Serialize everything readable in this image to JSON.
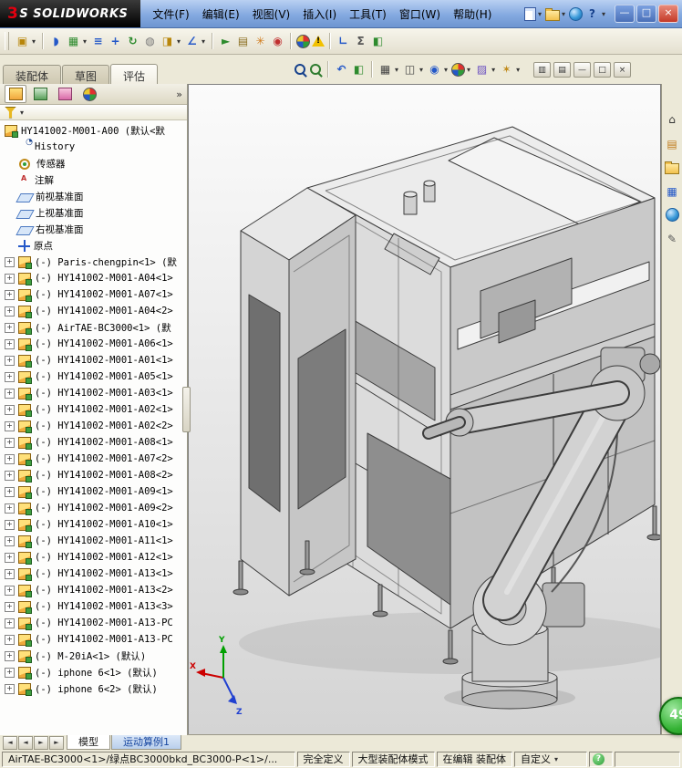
{
  "window": {
    "logo_accent": "3",
    "logo_rest": "S",
    "logo_name": "SOLIDWORKS",
    "buttons": {
      "minimize": "—",
      "maximize": "□",
      "close": "×"
    }
  },
  "menus": [
    {
      "id": "file",
      "label": "文件(F)"
    },
    {
      "id": "edit",
      "label": "编辑(E)"
    },
    {
      "id": "view",
      "label": "视图(V)"
    },
    {
      "id": "insert",
      "label": "插入(I)"
    },
    {
      "id": "tools",
      "label": "工具(T)"
    },
    {
      "id": "window",
      "label": "窗口(W)"
    },
    {
      "id": "help",
      "label": "帮助(H)"
    }
  ],
  "quick_icons": [
    {
      "id": "new-document",
      "kind": "page",
      "caret": true
    },
    {
      "id": "open",
      "kind": "folder",
      "caret": true
    },
    {
      "id": "solidworks-resources",
      "kind": "ball"
    },
    {
      "id": "help",
      "glyph": "?",
      "fg": "#16418c",
      "caret": true
    }
  ],
  "toolbar": {
    "icons": [
      {
        "id": "insert-components",
        "glyph": "▣",
        "fg": "#b8860b",
        "caret": true
      },
      {
        "sep": true
      },
      {
        "id": "mate",
        "glyph": "◗",
        "fg": "#2458c8"
      },
      {
        "id": "linear-component-pattern",
        "glyph": "▦",
        "fg": "#2e8b2e",
        "caret": true
      },
      {
        "id": "smart-fasteners",
        "glyph": "≡",
        "fg": "#2458c8"
      },
      {
        "id": "move-component",
        "glyph": "+",
        "fg": "#2458c8"
      },
      {
        "id": "rotate-component",
        "glyph": "↻",
        "fg": "#2e8b2e"
      },
      {
        "id": "show-hidden-components",
        "glyph": "◍",
        "fg": "#777777"
      },
      {
        "id": "assembly-features",
        "glyph": "◨",
        "fg": "#b8860b",
        "caret": true
      },
      {
        "id": "reference-geometry",
        "glyph": "∠",
        "fg": "#2458c8",
        "caret": true
      },
      {
        "sep": true
      },
      {
        "id": "new-motion-study",
        "glyph": "►",
        "fg": "#2e8b2e"
      },
      {
        "id": "bill-of-materials",
        "glyph": "▤",
        "fg": "#8a6d1f"
      },
      {
        "id": "exploded-view",
        "glyph": "✳",
        "fg": "#d07a1a"
      },
      {
        "id": "interference-detection",
        "glyph": "◉",
        "fg": "#c03030"
      },
      {
        "sep": true
      },
      {
        "id": "edit-appearance",
        "kind": "wheel"
      },
      {
        "id": "rebuild-warning",
        "kind": "tri",
        "glyph": "!"
      },
      {
        "sep": true
      },
      {
        "id": "measure",
        "glyph": "∟",
        "fg": "#2458c8"
      },
      {
        "id": "mass-properties",
        "glyph": "Σ",
        "fg": "#555555"
      },
      {
        "id": "section-properties",
        "glyph": "◧",
        "fg": "#2e8b2e"
      }
    ]
  },
  "command_tabs": [
    {
      "id": "assembly",
      "label": "装配体",
      "active": false
    },
    {
      "id": "sketch",
      "label": "草图",
      "active": false
    },
    {
      "id": "evaluate",
      "label": "评估",
      "active": true
    }
  ],
  "headsup": [
    {
      "id": "zoom-to-fit",
      "kind": "mag"
    },
    {
      "id": "zoom-to-area",
      "kind": "mag2"
    },
    {
      "sep": true
    },
    {
      "id": "previous-view",
      "glyph": "↶",
      "fg": "#2458c8"
    },
    {
      "id": "section-view",
      "glyph": "◧",
      "fg": "#2e8b2e"
    },
    {
      "sep": true
    },
    {
      "id": "view-orientation",
      "glyph": "▦",
      "fg": "#444444",
      "caret": true
    },
    {
      "id": "display-style",
      "glyph": "◫",
      "fg": "#444444",
      "caret": true
    },
    {
      "id": "hide-show-items",
      "glyph": "◉",
      "fg": "#2458c8",
      "caret": true
    },
    {
      "id": "edit-appearance-hud",
      "kind": "wheel",
      "caret": true
    },
    {
      "id": "apply-scene",
      "glyph": "▨",
      "fg": "#6a4fc0",
      "caret": true
    },
    {
      "id": "view-settings",
      "glyph": "✶",
      "fg": "#c08a1a",
      "caret": true
    }
  ],
  "doc_buttons": [
    {
      "id": "viewport-layout",
      "glyph": "▥"
    },
    {
      "id": "viewport-layout-2",
      "glyph": "▤"
    },
    {
      "id": "minimize-document",
      "glyph": "—"
    },
    {
      "id": "restore-document",
      "glyph": "□"
    },
    {
      "id": "close-document",
      "glyph": "×"
    }
  ],
  "panel": {
    "tabs": [
      {
        "id": "featuremanager",
        "kind": "asmtab"
      },
      {
        "id": "propertymanager",
        "kind": "proptab"
      },
      {
        "id": "configurationmanager",
        "kind": "cfgtab"
      },
      {
        "id": "displaymanager",
        "kind": "wheel"
      }
    ],
    "overflow": "»"
  },
  "tree": {
    "root": "HY141002-M001-A00 (默认<默",
    "items": [
      {
        "kind": "history",
        "label": "History"
      },
      {
        "kind": "sensor",
        "label": "传感器"
      },
      {
        "kind": "annotations",
        "label": "注解"
      },
      {
        "kind": "plane",
        "label": "前视基准面"
      },
      {
        "kind": "plane",
        "label": "上视基准面"
      },
      {
        "kind": "plane",
        "label": "右视基准面"
      },
      {
        "kind": "origin",
        "label": "原点"
      },
      {
        "kind": "component",
        "label": "(-) Paris-chengpin<1> (默"
      },
      {
        "kind": "component",
        "label": "(-) HY141002-M001-A04<1>"
      },
      {
        "kind": "component",
        "label": "(-) HY141002-M001-A07<1>"
      },
      {
        "kind": "component",
        "label": "(-) HY141002-M001-A04<2>"
      },
      {
        "kind": "component",
        "label": "(-) AirTAE-BC3000<1> (默"
      },
      {
        "kind": "component",
        "label": "(-) HY141002-M001-A06<1>"
      },
      {
        "kind": "component",
        "label": "(-) HY141002-M001-A01<1>"
      },
      {
        "kind": "component",
        "label": "(-) HY141002-M001-A05<1>"
      },
      {
        "kind": "component",
        "label": "(-) HY141002-M001-A03<1>"
      },
      {
        "kind": "component",
        "label": "(-) HY141002-M001-A02<1>"
      },
      {
        "kind": "component",
        "label": "(-) HY141002-M001-A02<2>"
      },
      {
        "kind": "component",
        "label": "(-) HY141002-M001-A08<1>"
      },
      {
        "kind": "component",
        "label": "(-) HY141002-M001-A07<2>"
      },
      {
        "kind": "component",
        "label": "(-) HY141002-M001-A08<2>"
      },
      {
        "kind": "component",
        "label": "(-) HY141002-M001-A09<1>"
      },
      {
        "kind": "component",
        "label": "(-) HY141002-M001-A09<2>"
      },
      {
        "kind": "component",
        "label": "(-) HY141002-M001-A10<1>"
      },
      {
        "kind": "component",
        "label": "(-) HY141002-M001-A11<1>"
      },
      {
        "kind": "component",
        "label": "(-) HY141002-M001-A12<1>"
      },
      {
        "kind": "component",
        "label": "(-) HY141002-M001-A13<1>"
      },
      {
        "kind": "component",
        "label": "(-) HY141002-M001-A13<2>"
      },
      {
        "kind": "component",
        "label": "(-) HY141002-M001-A13<3>"
      },
      {
        "kind": "component",
        "label": "(-) HY141002-M001-A13-PC"
      },
      {
        "kind": "component",
        "label": "(-) HY141002-M001-A13-PC"
      },
      {
        "kind": "component",
        "label": "(-) M-20iA<1> (默认)"
      },
      {
        "kind": "component",
        "label": "(-) iphone 6<1> (默认)"
      },
      {
        "kind": "component",
        "label": "(-) iphone 6<2> (默认)"
      }
    ]
  },
  "taskpane": [
    {
      "id": "home",
      "glyph": "⌂",
      "fg": "#333333"
    },
    {
      "id": "design-library",
      "glyph": "▤",
      "fg": "#c07a1a"
    },
    {
      "id": "file-explorer",
      "kind": "folder"
    },
    {
      "id": "view-palette",
      "glyph": "▦",
      "fg": "#2458c8"
    },
    {
      "id": "appearances",
      "kind": "ball"
    },
    {
      "id": "custom-properties",
      "glyph": "✎",
      "fg": "#555555"
    }
  ],
  "bottom": {
    "nav": [
      "◄",
      "◄",
      "►",
      "►"
    ],
    "tabs": [
      {
        "id": "model",
        "label": "模型",
        "active": true
      },
      {
        "id": "motion-study-1",
        "label": "运动算例1",
        "active": false,
        "accent": true
      }
    ]
  },
  "status": {
    "path": "AirTAE-BC3000<1>/绿点BC3000bkd_BC3000-P<1>/...",
    "defined": "完全定义",
    "mode": "大型装配体模式",
    "editing": "在编辑 装配体",
    "custom": "自定义",
    "help_glyph": "?"
  },
  "overlay": {
    "badge": "49"
  },
  "triad": {
    "x": "X",
    "y": "Y",
    "z": "Z"
  },
  "colors": {
    "accent_blue": "#2458c8",
    "close_red": "#c43a28",
    "badge_green": "#35b335",
    "toolbar_tan": "#ece9d8"
  }
}
